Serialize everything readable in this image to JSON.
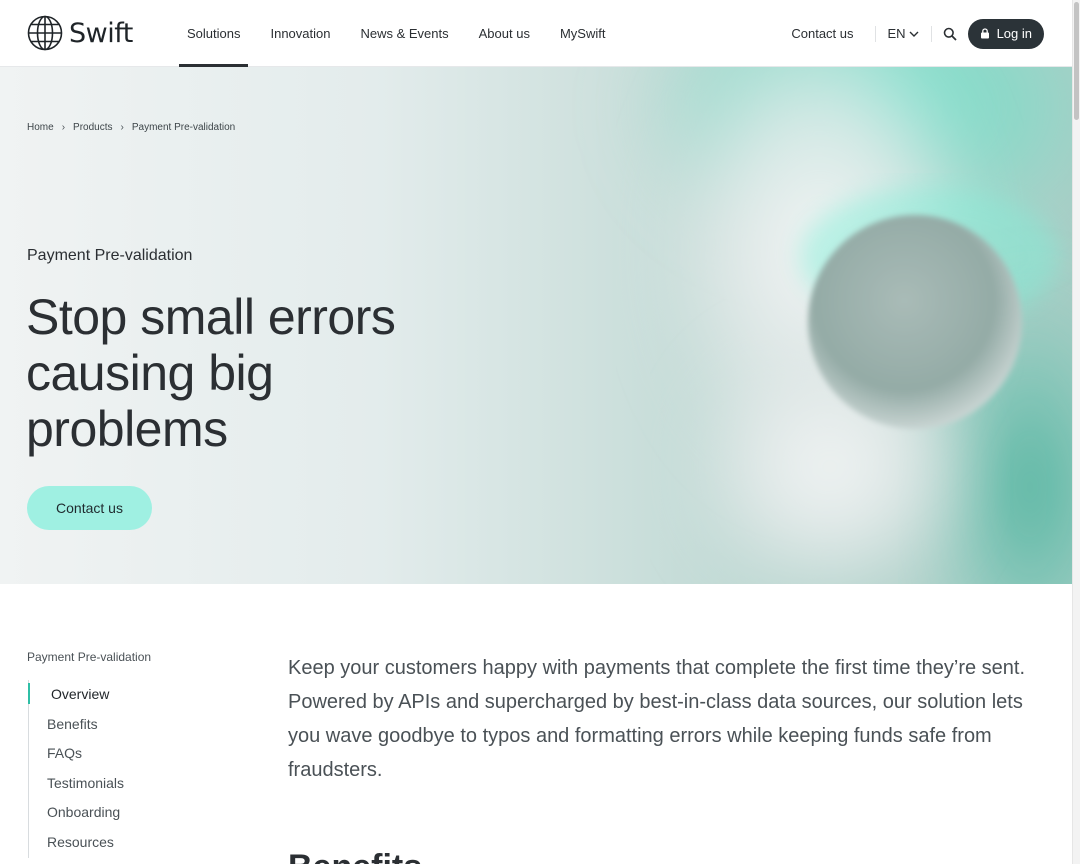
{
  "header": {
    "logo_text": "Swift",
    "nav": [
      "Solutions",
      "Innovation",
      "News & Events",
      "About us",
      "MySwift"
    ],
    "active_nav": "Solutions",
    "contact_label": "Contact us",
    "language": "EN",
    "login_label": "Log in"
  },
  "hero": {
    "breadcrumb": [
      "Home",
      "Products",
      "Payment Pre-validation"
    ],
    "eyebrow": "Payment Pre-validation",
    "title_lines": [
      "Stop small errors",
      "causing big",
      "problems"
    ],
    "cta_label": "Contact us"
  },
  "content": {
    "side_label": "Payment Pre-validation",
    "side_nav": [
      "Overview",
      "Benefits",
      "FAQs",
      "Testimonials",
      "Onboarding",
      "Resources"
    ],
    "active_side_item": "Overview",
    "intro": "Keep your customers happy with payments that complete the first time they’re sent. Powered by APIs and supercharged by best-in-class data sources, our solution lets you wave goodbye to typos and formatting errors while keeping funds safe from fraudsters.",
    "next_heading": "Benefits"
  },
  "icons": {
    "logo": "globe-icon",
    "language": "chevron-down-icon",
    "search": "search-icon",
    "login": "lock-icon",
    "breadcrumb_separator": "chevron-right-icon"
  },
  "colors": {
    "primary_text": "#2b2f33",
    "cta_background": "#9ff0e2",
    "login_background": "#2b3338",
    "accent": "#2fbfa6"
  }
}
